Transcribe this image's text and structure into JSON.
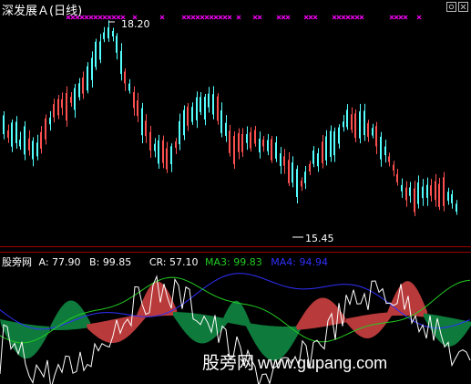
{
  "window": {
    "title": "深发展Ａ(日线)",
    "title_color": "#ffffff",
    "controls": [
      {
        "name": "gear-icon"
      },
      {
        "name": "close-icon"
      }
    ]
  },
  "colors": {
    "background": "#000000",
    "panel_border": "#a00000",
    "up_candle": "#ff5050",
    "down_candle": "#54ffff",
    "signal_marker": "#ff00ff",
    "cr": "#ffffff",
    "ma3": "#22cc22",
    "ma4": "#3030ff",
    "band_green": "#0e7a3c",
    "band_red": "#b83a3a"
  },
  "price_panel": {
    "high_label": "18.20",
    "low_label": "15.45",
    "top_markers": "★"
  },
  "indicator_panel": {
    "name": "股旁网",
    "a_label": "A:",
    "a_value": "77.90",
    "b_label": "B:",
    "b_value": "99.85",
    "cr_label": "CR:",
    "cr_value": "57.10",
    "ma3_label": "MA3:",
    "ma3_value": "99.83",
    "ma4_label": "MA4:",
    "ma4_value": "94.94"
  },
  "watermark": {
    "text": "股旁网",
    "url": "www.gupang.com"
  }
}
